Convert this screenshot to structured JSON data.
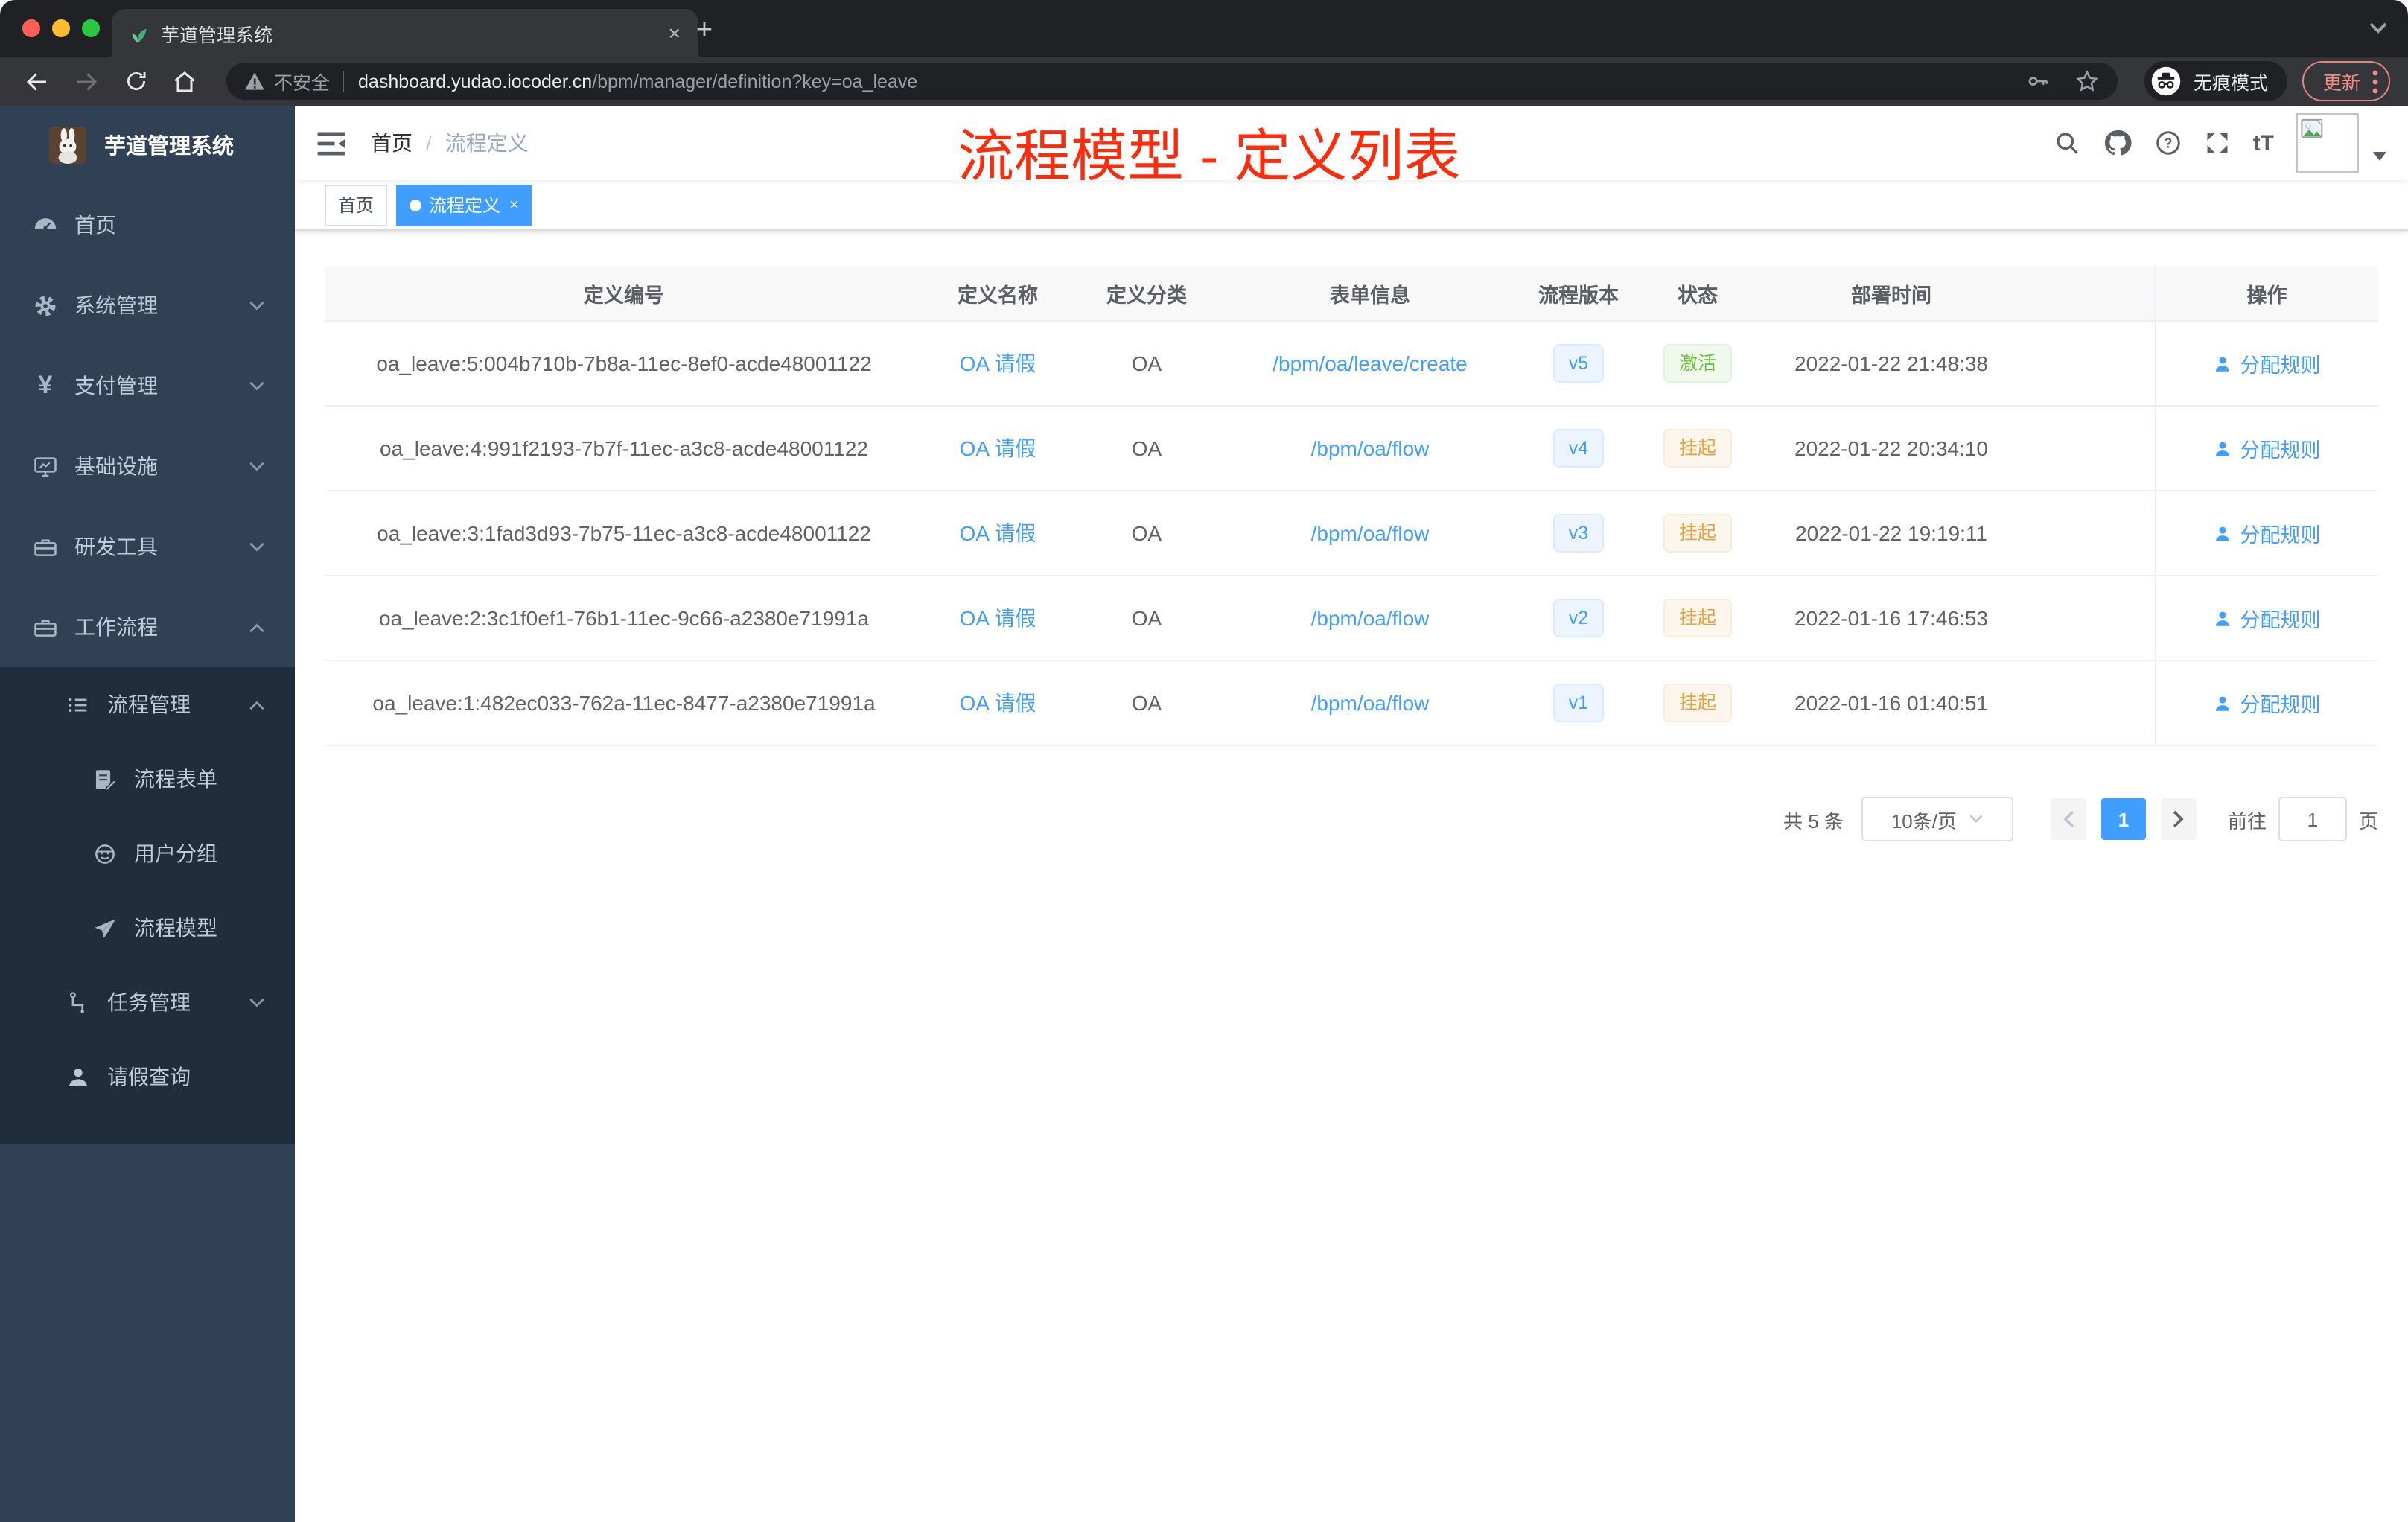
{
  "browser": {
    "tab_title": "芋道管理系统",
    "security_label": "不安全",
    "url_host": "dashboard.yudao.iocoder.cn",
    "url_path": "/bpm/manager/definition?key=oa_leave",
    "incognito_label": "无痕模式",
    "update_label": "更新"
  },
  "icons": {
    "close_glyph": "×",
    "plus_glyph": "+",
    "font_size_glyph": "tT",
    "prev_glyph": "‹",
    "next_glyph": "›"
  },
  "sidebar": {
    "app_title": "芋道管理系统",
    "items": [
      {
        "label": "首页",
        "icon": "dashboard-icon",
        "chevron": ""
      },
      {
        "label": "系统管理",
        "icon": "gear-icon",
        "chevron": "down"
      },
      {
        "label": "支付管理",
        "icon": "yen-icon",
        "chevron": "down"
      },
      {
        "label": "基础设施",
        "icon": "monitor-icon",
        "chevron": "down"
      },
      {
        "label": "研发工具",
        "icon": "toolbox-icon",
        "chevron": "down"
      },
      {
        "label": "工作流程",
        "icon": "toolbox-icon",
        "chevron": "up"
      },
      {
        "label": "流程管理",
        "icon": "list-icon",
        "chevron": "up"
      },
      {
        "label": "流程表单",
        "icon": "form-icon",
        "chevron": ""
      },
      {
        "label": "用户分组",
        "icon": "robot-icon",
        "chevron": ""
      },
      {
        "label": "流程模型",
        "icon": "send-icon",
        "chevron": ""
      },
      {
        "label": "任务管理",
        "icon": "tree-icon",
        "chevron": "down"
      },
      {
        "label": "请假查询",
        "icon": "user-icon",
        "chevron": ""
      }
    ]
  },
  "navbar": {
    "breadcrumb": {
      "home": "首页",
      "current": "流程定义"
    },
    "annotation": "流程模型 - 定义列表"
  },
  "tags_view": {
    "tabs": [
      {
        "label": "首页"
      },
      {
        "label": "流程定义"
      }
    ]
  },
  "table": {
    "columns": [
      "定义编号",
      "定义名称",
      "定义分类",
      "表单信息",
      "流程版本",
      "状态",
      "部署时间",
      "操作"
    ],
    "rows": [
      {
        "id": "oa_leave:5:004b710b-7b8a-11ec-8ef0-acde48001122",
        "name": "OA 请假",
        "category": "OA",
        "form": "/bpm/oa/leave/create",
        "version": "v5",
        "status": "激活",
        "status_class": "tag tag-green",
        "deploy_time": "2022-01-22 21:48:38",
        "action": "分配规则"
      },
      {
        "id": "oa_leave:4:991f2193-7b7f-11ec-a3c8-acde48001122",
        "name": "OA 请假",
        "category": "OA",
        "form": "/bpm/oa/flow",
        "version": "v4",
        "status": "挂起",
        "status_class": "tag tag-yellow",
        "deploy_time": "2022-01-22 20:34:10",
        "action": "分配规则"
      },
      {
        "id": "oa_leave:3:1fad3d93-7b75-11ec-a3c8-acde48001122",
        "name": "OA 请假",
        "category": "OA",
        "form": "/bpm/oa/flow",
        "version": "v3",
        "status": "挂起",
        "status_class": "tag tag-yellow",
        "deploy_time": "2022-01-22 19:19:11",
        "action": "分配规则"
      },
      {
        "id": "oa_leave:2:3c1f0ef1-76b1-11ec-9c66-a2380e71991a",
        "name": "OA 请假",
        "category": "OA",
        "form": "/bpm/oa/flow",
        "version": "v2",
        "status": "挂起",
        "status_class": "tag tag-yellow",
        "deploy_time": "2022-01-16 17:46:53",
        "action": "分配规则"
      },
      {
        "id": "oa_leave:1:482ec033-762a-11ec-8477-a2380e71991a",
        "name": "OA 请假",
        "category": "OA",
        "form": "/bpm/oa/flow",
        "version": "v1",
        "status": "挂起",
        "status_class": "tag tag-yellow",
        "deploy_time": "2022-01-16 01:40:51",
        "action": "分配规则"
      }
    ]
  },
  "pagination": {
    "total": "共 5 条",
    "page_size": "10条/页",
    "current_page": "1",
    "goto": "前往",
    "goto_value": "1",
    "unit": "页"
  },
  "colors": {
    "primary": "#409eff",
    "status_active_green": "#67c23a",
    "status_suspend_yellow": "#e6a23c",
    "annotation_red": "#fb2c0c",
    "sidebar_bg": "#304156",
    "submenu_bg": "#1f2d3d"
  }
}
